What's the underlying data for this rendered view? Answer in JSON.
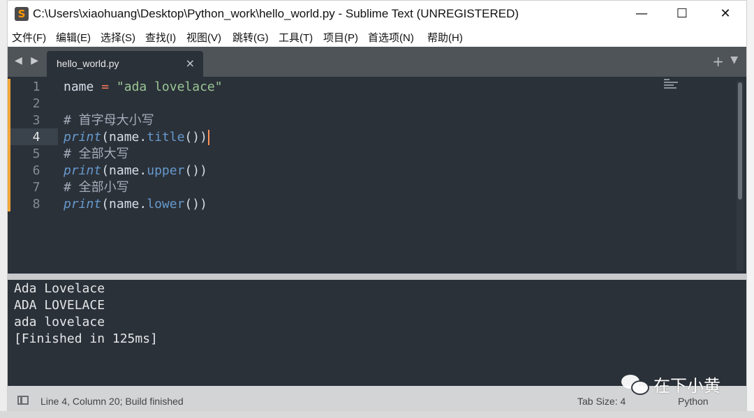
{
  "window": {
    "title": "C:\\Users\\xiaohuang\\Desktop\\Python_work\\hello_world.py - Sublime Text (UNREGISTERED)",
    "minimize": "—",
    "maximize": "☐",
    "close": "✕"
  },
  "menu": [
    "文件(F)",
    "编辑(E)",
    "选择(S)",
    "查找(I)",
    "视图(V)",
    "跳转(G)",
    "工具(T)",
    "项目(P)",
    "首选项(N)",
    "帮助(H)"
  ],
  "tabs": {
    "nav": "◀ ▶",
    "active_tab": "hello_world.py",
    "close": "×",
    "new_tab": "+",
    "tab_menu": "▼"
  },
  "editor": {
    "active_line": 4,
    "lines": [
      {
        "num": "1",
        "tokens": [
          {
            "t": "name",
            "c": "var"
          },
          {
            "t": " ",
            "c": "var"
          },
          {
            "t": "=",
            "c": "op"
          },
          {
            "t": " ",
            "c": "var"
          },
          {
            "t": "\"ada lovelace\"",
            "c": "str"
          }
        ]
      },
      {
        "num": "2",
        "tokens": []
      },
      {
        "num": "3",
        "tokens": [
          {
            "t": "# 首字母大小写",
            "c": "com"
          }
        ]
      },
      {
        "num": "4",
        "tokens": [
          {
            "t": "print",
            "c": "fn"
          },
          {
            "t": "(",
            "c": "paren"
          },
          {
            "t": "name",
            "c": "var"
          },
          {
            "t": ".",
            "c": "var"
          },
          {
            "t": "title",
            "c": "meth"
          },
          {
            "t": "())",
            "c": "paren"
          }
        ]
      },
      {
        "num": "5",
        "tokens": [
          {
            "t": "# 全部大写",
            "c": "com"
          }
        ]
      },
      {
        "num": "6",
        "tokens": [
          {
            "t": "print",
            "c": "fn"
          },
          {
            "t": "(",
            "c": "paren"
          },
          {
            "t": "name",
            "c": "var"
          },
          {
            "t": ".",
            "c": "var"
          },
          {
            "t": "upper",
            "c": "meth"
          },
          {
            "t": "())",
            "c": "paren"
          }
        ]
      },
      {
        "num": "7",
        "tokens": [
          {
            "t": "# 全部小写",
            "c": "com"
          }
        ]
      },
      {
        "num": "8",
        "tokens": [
          {
            "t": "print",
            "c": "fn"
          },
          {
            "t": "(",
            "c": "paren"
          },
          {
            "t": "name",
            "c": "var"
          },
          {
            "t": ".",
            "c": "var"
          },
          {
            "t": "lower",
            "c": "meth"
          },
          {
            "t": "())",
            "c": "paren"
          }
        ]
      }
    ]
  },
  "output": [
    "Ada Lovelace",
    "ADA LOVELACE",
    "ada lovelace",
    "[Finished in 125ms]"
  ],
  "status": {
    "position": "Line 4, Column 20; Build finished",
    "tab_size": "Tab Size: 4",
    "syntax": "Python"
  },
  "watermark": "在下小黄",
  "colors": {
    "editor_bg": "#2b3139",
    "gutter_modified": "#f3a63a",
    "string": "#99c794",
    "function": "#6699cc",
    "operator": "#f97b58",
    "comment": "#a6acb9"
  }
}
